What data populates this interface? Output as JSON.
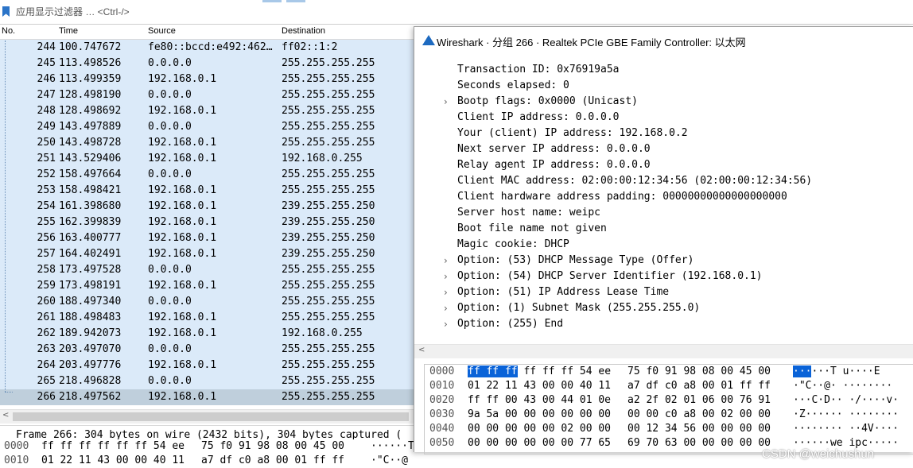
{
  "filter": {
    "placeholder": "应用显示过滤器 … <Ctrl-/>"
  },
  "packet_list": {
    "columns": [
      "No.",
      "Time",
      "Source",
      "Destination"
    ],
    "rows": [
      {
        "no": "244",
        "time": "100.747672",
        "src": "fe80::bccd:e492:462…",
        "dst": "ff02::1:2"
      },
      {
        "no": "245",
        "time": "113.498526",
        "src": "0.0.0.0",
        "dst": "255.255.255.255"
      },
      {
        "no": "246",
        "time": "113.499359",
        "src": "192.168.0.1",
        "dst": "255.255.255.255"
      },
      {
        "no": "247",
        "time": "128.498190",
        "src": "0.0.0.0",
        "dst": "255.255.255.255"
      },
      {
        "no": "248",
        "time": "128.498692",
        "src": "192.168.0.1",
        "dst": "255.255.255.255"
      },
      {
        "no": "249",
        "time": "143.497889",
        "src": "0.0.0.0",
        "dst": "255.255.255.255"
      },
      {
        "no": "250",
        "time": "143.498728",
        "src": "192.168.0.1",
        "dst": "255.255.255.255"
      },
      {
        "no": "251",
        "time": "143.529406",
        "src": "192.168.0.1",
        "dst": "192.168.0.255"
      },
      {
        "no": "252",
        "time": "158.497664",
        "src": "0.0.0.0",
        "dst": "255.255.255.255"
      },
      {
        "no": "253",
        "time": "158.498421",
        "src": "192.168.0.1",
        "dst": "255.255.255.255"
      },
      {
        "no": "254",
        "time": "161.398680",
        "src": "192.168.0.1",
        "dst": "239.255.255.250"
      },
      {
        "no": "255",
        "time": "162.399839",
        "src": "192.168.0.1",
        "dst": "239.255.255.250"
      },
      {
        "no": "256",
        "time": "163.400777",
        "src": "192.168.0.1",
        "dst": "239.255.255.250"
      },
      {
        "no": "257",
        "time": "164.402491",
        "src": "192.168.0.1",
        "dst": "239.255.255.250"
      },
      {
        "no": "258",
        "time": "173.497528",
        "src": "0.0.0.0",
        "dst": "255.255.255.255"
      },
      {
        "no": "259",
        "time": "173.498191",
        "src": "192.168.0.1",
        "dst": "255.255.255.255"
      },
      {
        "no": "260",
        "time": "188.497340",
        "src": "0.0.0.0",
        "dst": "255.255.255.255"
      },
      {
        "no": "261",
        "time": "188.498483",
        "src": "192.168.0.1",
        "dst": "255.255.255.255"
      },
      {
        "no": "262",
        "time": "189.942073",
        "src": "192.168.0.1",
        "dst": "192.168.0.255"
      },
      {
        "no": "263",
        "time": "203.497070",
        "src": "0.0.0.0",
        "dst": "255.255.255.255"
      },
      {
        "no": "264",
        "time": "203.497776",
        "src": "192.168.0.1",
        "dst": "255.255.255.255"
      },
      {
        "no": "265",
        "time": "218.496828",
        "src": "0.0.0.0",
        "dst": "255.255.255.255"
      },
      {
        "no": "266",
        "time": "218.497562",
        "src": "192.168.0.1",
        "dst": "255.255.255.255"
      }
    ],
    "selected_no": "266"
  },
  "detail_strip": "Frame 266: 304 bytes on wire (2432 bits), 304 bytes captured (",
  "bottom_bytes": [
    {
      "offset": "0000",
      "hex1": "ff ff ff ff ff ff 54 ee",
      "hex2": "75 f0 91 98 08 00 45 00",
      "ascii": "······T"
    },
    {
      "offset": "0010",
      "hex1": "01 22 11 43 00 00 40 11",
      "hex2": "a7 df c0 a8 00 01 ff ff",
      "ascii": "·\"C··@"
    }
  ],
  "popup": {
    "title": "Wireshark · 分组 266 · Realtek PCIe GBE Family Controller: 以太网",
    "tree": [
      {
        "text": "Transaction ID: 0x76919a5a",
        "expandable": false
      },
      {
        "text": "Seconds elapsed: 0",
        "expandable": false
      },
      {
        "text": "Bootp flags: 0x0000 (Unicast)",
        "expandable": true
      },
      {
        "text": "Client IP address: 0.0.0.0",
        "expandable": false
      },
      {
        "text": "Your (client) IP address: 192.168.0.2",
        "expandable": false
      },
      {
        "text": "Next server IP address: 0.0.0.0",
        "expandable": false
      },
      {
        "text": "Relay agent IP address: 0.0.0.0",
        "expandable": false
      },
      {
        "text": "Client MAC address: 02:00:00:12:34:56 (02:00:00:12:34:56)",
        "expandable": false
      },
      {
        "text": "Client hardware address padding: 00000000000000000000",
        "expandable": false
      },
      {
        "text": "Server host name: weipc",
        "expandable": false
      },
      {
        "text": "Boot file name not given",
        "expandable": false
      },
      {
        "text": "Magic cookie: DHCP",
        "expandable": false
      },
      {
        "text": "Option: (53) DHCP Message Type (Offer)",
        "expandable": true
      },
      {
        "text": "Option: (54) DHCP Server Identifier (192.168.0.1)",
        "expandable": true
      },
      {
        "text": "Option: (51) IP Address Lease Time",
        "expandable": true
      },
      {
        "text": "Option: (1) Subnet Mask (255.255.255.0)",
        "expandable": true
      },
      {
        "text": "Option: (255) End",
        "expandable": true
      }
    ],
    "hex": [
      {
        "offset": "0000",
        "hl": "ff ff ff",
        "hex1": " ff ff ff 54 ee",
        "hex2": "75 f0 91 98 08 00 45 00",
        "ahl": "···",
        "ascii": "···T u····E"
      },
      {
        "offset": "0010",
        "hl": "",
        "hex1": "01 22 11 43 00 00 40 11",
        "hex2": "a7 df c0 a8 00 01 ff ff",
        "ahl": "",
        "ascii": "·\"C··@· ········"
      },
      {
        "offset": "0020",
        "hl": "",
        "hex1": "ff ff 00 43 00 44 01 0e",
        "hex2": "a2 2f 02 01 06 00 76 91",
        "ahl": "",
        "ascii": "···C·D·· ·/····v·"
      },
      {
        "offset": "0030",
        "hl": "",
        "hex1": "9a 5a 00 00 00 00 00 00",
        "hex2": "00 00 c0 a8 00 02 00 00",
        "ahl": "",
        "ascii": "·Z······ ········"
      },
      {
        "offset": "0040",
        "hl": "",
        "hex1": "00 00 00 00 00 02 00 00",
        "hex2": "00 12 34 56 00 00 00 00",
        "ahl": "",
        "ascii": "········ ··4V····"
      },
      {
        "offset": "0050",
        "hl": "",
        "hex1": "00 00 00 00 00 00 77 65",
        "hex2": "69 70 63 00 00 00 00 00",
        "ahl": "",
        "ascii": "······we ipc·····"
      }
    ]
  },
  "watermark": "CSDN @weichushun",
  "colors": {
    "row_bg": "#dbeaf9",
    "selected_row_bg": "#bfcfdc",
    "hex_highlight": "#0a63d8"
  }
}
